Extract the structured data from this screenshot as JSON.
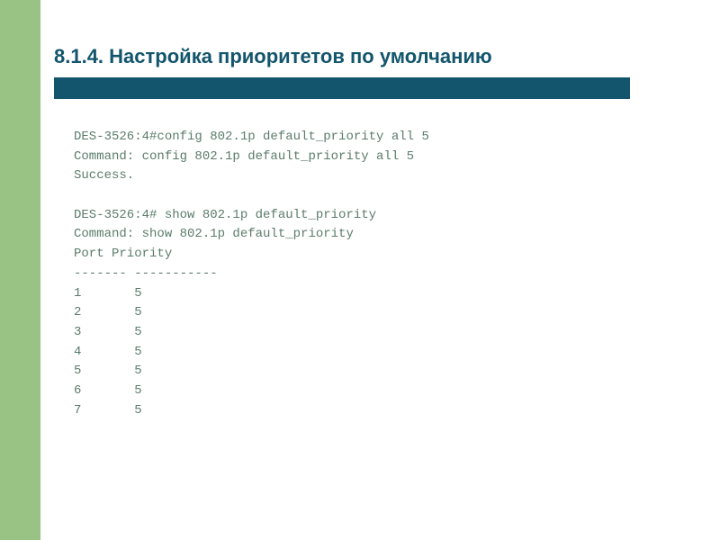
{
  "heading": "8.1.4. Настройка приоритетов по умолчанию",
  "terminal": {
    "lines": [
      "DES-3526:4#config 802.1p default_priority all 5",
      "Command: config 802.1p default_priority all 5",
      "Success.",
      "",
      "DES-3526:4# show 802.1p default_priority",
      "Command: show 802.1p default_priority",
      "Port Priority",
      "------- -----------",
      "1       5",
      "2       5",
      "3       5",
      "4       5",
      "5       5",
      "6       5",
      "7       5"
    ]
  },
  "colors": {
    "sidebar": "#99c285",
    "heading": "#12556d",
    "underline": "#12556d",
    "terminal_text": "#5b7c6b"
  }
}
